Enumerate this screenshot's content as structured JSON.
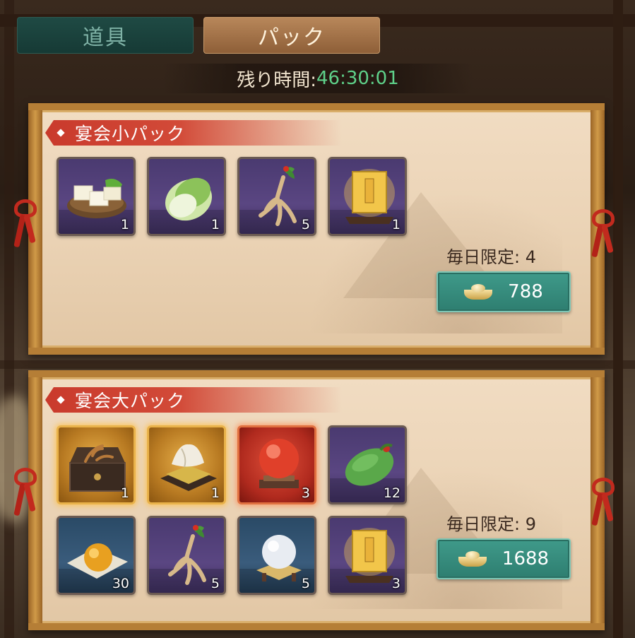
{
  "tabs": [
    {
      "label": "道具",
      "active": false
    },
    {
      "label": "パック",
      "active": true
    }
  ],
  "timer": {
    "label": "残り時間:",
    "value": "46:30:01"
  },
  "packs": [
    {
      "title": "宴会小パック",
      "items": [
        {
          "icon": "tofu-icon",
          "count": "1"
        },
        {
          "icon": "cabbage-icon",
          "count": "1"
        },
        {
          "icon": "ginseng-icon",
          "count": "5"
        },
        {
          "icon": "lantern-icon",
          "count": "1"
        }
      ],
      "limit_label": "毎日限定: 4",
      "price": "788"
    },
    {
      "title": "宴会大パック",
      "items": [
        {
          "icon": "antler-chest-icon",
          "count": "1"
        },
        {
          "icon": "cloth-bundle-icon",
          "count": "1"
        },
        {
          "icon": "red-orb-icon",
          "count": "3"
        },
        {
          "icon": "green-melon-icon",
          "count": "12"
        },
        {
          "icon": "golden-pearl-icon",
          "count": "30"
        },
        {
          "icon": "ginseng-icon",
          "count": "5"
        },
        {
          "icon": "white-pearl-icon",
          "count": "5"
        },
        {
          "icon": "lantern-icon",
          "count": "3"
        }
      ],
      "limit_label": "毎日限定: 9",
      "price": "1688"
    }
  ],
  "colors": {
    "timer_value": "#5fd18a",
    "ribbon": "#c93a2c",
    "buy_button": "#2e7e70"
  }
}
